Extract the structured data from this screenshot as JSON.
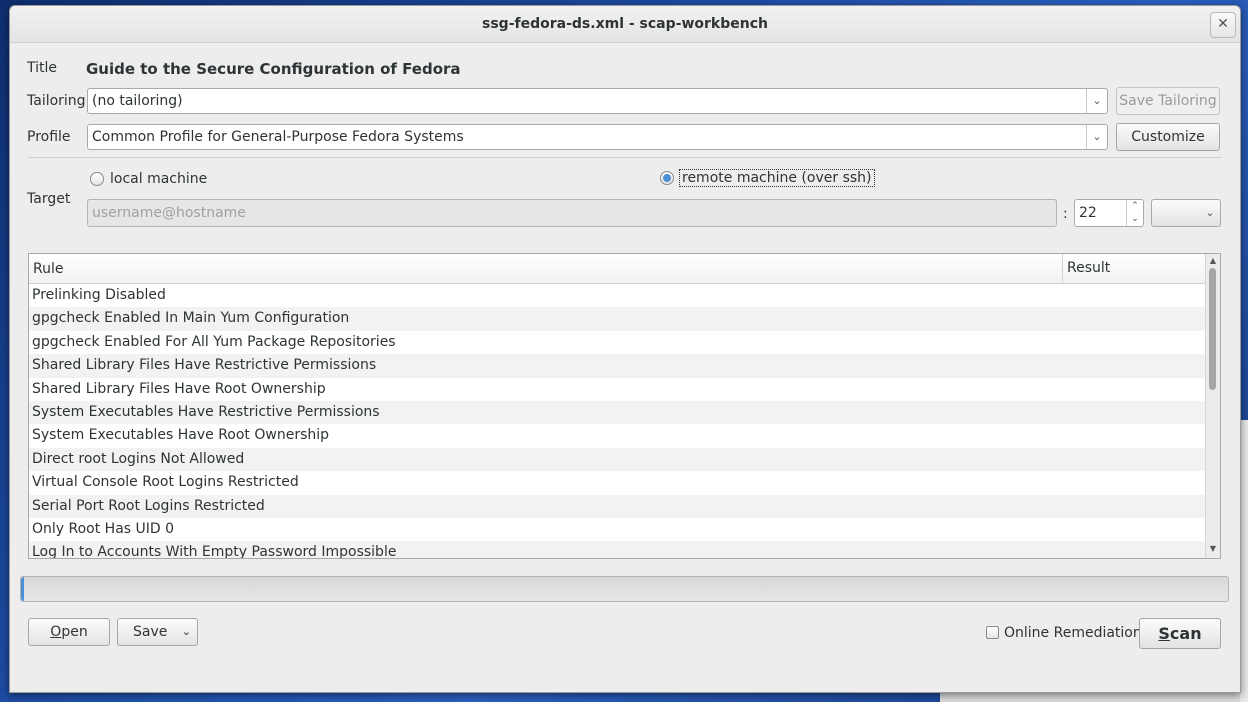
{
  "window": {
    "title": "ssg-fedora-ds.xml - scap-workbench"
  },
  "title_row": {
    "label": "Title",
    "value": "Guide to the Secure Configuration of Fedora"
  },
  "tailoring": {
    "label": "Tailoring",
    "selected": "(no tailoring)",
    "save_button": "Save Tailoring"
  },
  "profile": {
    "label": "Profile",
    "selected": "Common Profile for General-Purpose Fedora Systems",
    "customize_button": "Customize"
  },
  "target": {
    "label": "Target",
    "local_label": "local machine",
    "remote_label": "remote machine (over ssh)",
    "selected": "remote",
    "host_placeholder": "username@hostname",
    "port_separator": ":",
    "port": "22"
  },
  "table": {
    "columns": [
      "Rule",
      "Result"
    ],
    "rows": [
      "Prelinking Disabled",
      "gpgcheck Enabled In Main Yum Configuration",
      "gpgcheck Enabled For All Yum Package Repositories",
      "Shared Library Files Have Restrictive Permissions",
      "Shared Library Files Have Root Ownership",
      "System Executables Have Restrictive Permissions",
      "System Executables Have Root Ownership",
      "Direct root Logins Not Allowed",
      "Virtual Console Root Logins Restricted",
      "Serial Port Root Logins Restricted",
      "Only Root Has UID 0",
      "Log In to Accounts With Empty Password Impossible"
    ]
  },
  "progress": {
    "value": 0
  },
  "bottom": {
    "open_rest": "pen",
    "open_mnemonic": "O",
    "save_label": "Save",
    "online_remediation": "Online Remediation",
    "scan_mnemonic": "S",
    "scan_rest": "can"
  },
  "icons": {
    "close": "close-icon",
    "dropdown": "chevron-down-icon",
    "spin_up": "chevron-up-icon",
    "spin_down": "chevron-down-icon"
  },
  "colors": {
    "accent": "#4a90d9",
    "window_bg": "#ededed"
  }
}
